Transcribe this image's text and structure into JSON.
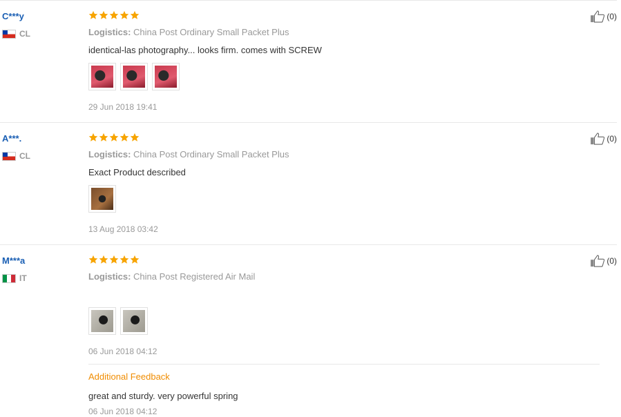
{
  "reviews": [
    {
      "user": "C***y",
      "country_code": "CL",
      "rating": 5,
      "logistics_label": "Logistics:",
      "logistics": "China Post Ordinary Small Packet Plus",
      "text": "identical-las photography... looks firm. comes with SCREW",
      "photos": [
        "red-photo",
        "red-photo",
        "red-photo"
      ],
      "date": "29 Jun 2018 19:41",
      "likes": "(0)"
    },
    {
      "user": "A***.",
      "country_code": "CL",
      "rating": 5,
      "logistics_label": "Logistics:",
      "logistics": "China Post Ordinary Small Packet Plus",
      "text": "Exact Product described",
      "photos": [
        "brown-photo"
      ],
      "date": "13 Aug 2018 03:42",
      "likes": "(0)"
    },
    {
      "user": "M***a",
      "country_code": "IT",
      "rating": 5,
      "logistics_label": "Logistics:",
      "logistics": "China Post Registered Air Mail",
      "text": "",
      "photos": [
        "grey-photo",
        "grey-photo"
      ],
      "date": "06 Jun 2018 04:12",
      "likes": "(0)",
      "additional": {
        "title": "Additional Feedback",
        "text": "great and sturdy. very powerful spring",
        "date": "06 Jun 2018 04:12"
      }
    }
  ],
  "colors": {
    "star": "#f7a400",
    "username": "#1a5fb4",
    "additional_title": "#f08c00"
  }
}
